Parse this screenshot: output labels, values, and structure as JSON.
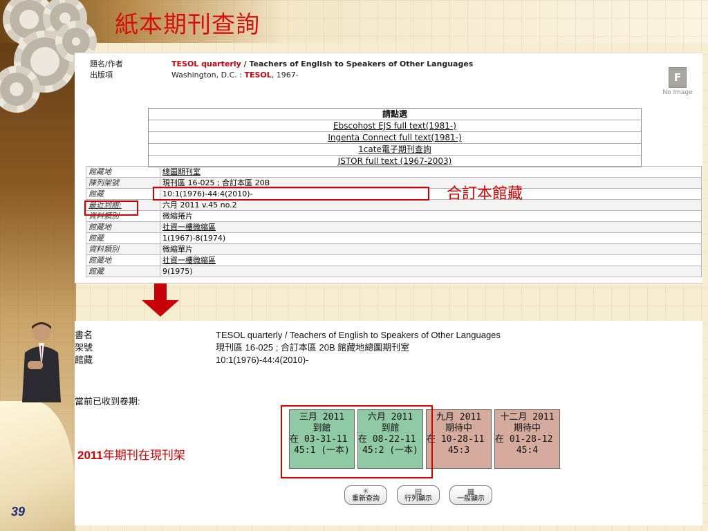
{
  "slide": {
    "title": "紙本期刊查詢",
    "page_number": "39",
    "callout_bound": "合訂本館藏",
    "callout_shelf_prefix": "2011",
    "callout_shelf_rest": "年期刊在現刊架"
  },
  "record": {
    "title_label": "題名/作者",
    "title_main": "TESOL quarterly",
    "title_sep": " / ",
    "title_rest": "Teachers of English to Speakers of Other Languages",
    "pub_label": "出版項",
    "pub_place": "Washington, D.C. : ",
    "pub_name": "TESOL",
    "pub_year": ", 1967-",
    "no_image_letter": "F",
    "no_image_text": "No Image"
  },
  "links": {
    "header": "請點選",
    "items": [
      "Ebscohost EJS full text(1981-)",
      "Ingenta Connect full text(1981-)",
      "1cate電子期刊查詢",
      "JSTOR full text (1967-2003)"
    ]
  },
  "holdings": [
    {
      "key": "館藏地",
      "value": "總圖期刊室",
      "link": true
    },
    {
      "key": "陳列架號",
      "value": "現刊區 16-025 ; 合訂本區 20B",
      "link": false
    },
    {
      "key": "館藏",
      "value": "10:1(1976)-44:4(2010)-",
      "link": false
    },
    {
      "key": "最近到館:",
      "value": "六月 2011 v.45 no.2",
      "link": false
    },
    {
      "key": "資料類別",
      "value": "微縮捲片",
      "link": false
    },
    {
      "key": "館藏地",
      "value": "社資一樓微縮區",
      "link": true
    },
    {
      "key": "館藏",
      "value": "1(1967)-8(1974)",
      "link": false
    },
    {
      "key": "資料類別",
      "value": "微縮單片",
      "link": false
    },
    {
      "key": "館藏地",
      "value": "社資一樓微縮區",
      "link": true
    },
    {
      "key": "館藏",
      "value": "9(1975)",
      "link": false
    }
  ],
  "brief": {
    "title_label": "書名",
    "title_value": "TESOL quarterly / Teachers of English to Speakers of Other Languages",
    "call_label": "架號",
    "call_value": "現刊區 16-025 ; 合訂本區 20B  館藏地總圖期刊室",
    "holding_label": "館藏",
    "holding_value": "10:1(1976)-44:4(2010)-",
    "received_label": "當前已收到卷期:"
  },
  "issues": [
    {
      "date": "三月 2011",
      "status": "到館",
      "on": "在 03-31-11",
      "vol": "45:1 (一本)",
      "state": "arrived"
    },
    {
      "date": "六月 2011",
      "status": "到館",
      "on": "在 08-22-11",
      "vol": "45:2 (一本)",
      "state": "arrived"
    },
    {
      "date": "九月 2011",
      "status": "期待中",
      "on": "在 10-28-11",
      "vol": "45:3",
      "state": "expected"
    },
    {
      "date": "十二月 2011",
      "status": "期待中",
      "on": "在 01-28-12",
      "vol": "45:4",
      "state": "expected"
    }
  ],
  "buttons": {
    "research": "重新查詢",
    "list_view": "行列顯示",
    "normal_view": "一般顯示"
  },
  "colors": {
    "accent_red": "#d21010",
    "arrived": "#8fcaa4",
    "expected": "#d4ab9c"
  }
}
